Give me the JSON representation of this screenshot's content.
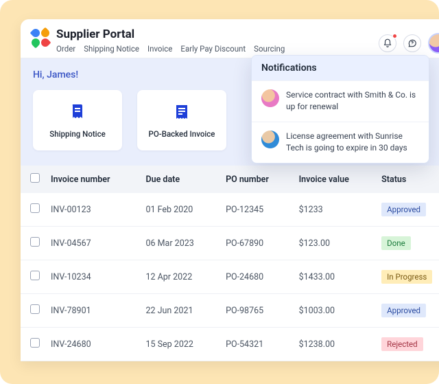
{
  "brand": "Supplier Portal",
  "nav": {
    "items": [
      "Order",
      "Shipping Notice",
      "Invoice",
      "Early Pay Discount",
      "Sourcing"
    ]
  },
  "greeting": "Hi, James!",
  "tiles": [
    {
      "label": "Shipping Notice"
    },
    {
      "label": "PO-Backed Invoice"
    }
  ],
  "notifications": {
    "title": "Notifications",
    "items": [
      {
        "text": "Service contract with Smith & Co. is up for renewal"
      },
      {
        "text": "License agreement with Sunrise Tech is going to expire in 30 days"
      }
    ]
  },
  "table": {
    "columns": [
      "Invoice number",
      "Due date",
      "PO number",
      "Invoice value",
      "Status"
    ],
    "rows": [
      {
        "invoice": "INV-00123",
        "due": "01 Feb 2020",
        "po": "PO-12345",
        "value": "$1233",
        "status": "Approved",
        "status_class": "b-approved"
      },
      {
        "invoice": "INV-04567",
        "due": "06 Mar 2023",
        "po": "PO-67890",
        "value": "$123.00",
        "status": "Done",
        "status_class": "b-done"
      },
      {
        "invoice": "INV-10234",
        "due": "12 Apr 2022",
        "po": "PO-24680",
        "value": "$1433.00",
        "status": "In Progress",
        "status_class": "b-inprogress"
      },
      {
        "invoice": "INV-78901",
        "due": "22 Jun 2021",
        "po": "PO-98765",
        "value": "$1003.00",
        "status": "Approved",
        "status_class": "b-approved"
      },
      {
        "invoice": "INV-24680",
        "due": "15 Sep 2022",
        "po": "PO-54321",
        "value": "$1238.00",
        "status": "Rejected",
        "status_class": "b-rejected"
      }
    ]
  }
}
